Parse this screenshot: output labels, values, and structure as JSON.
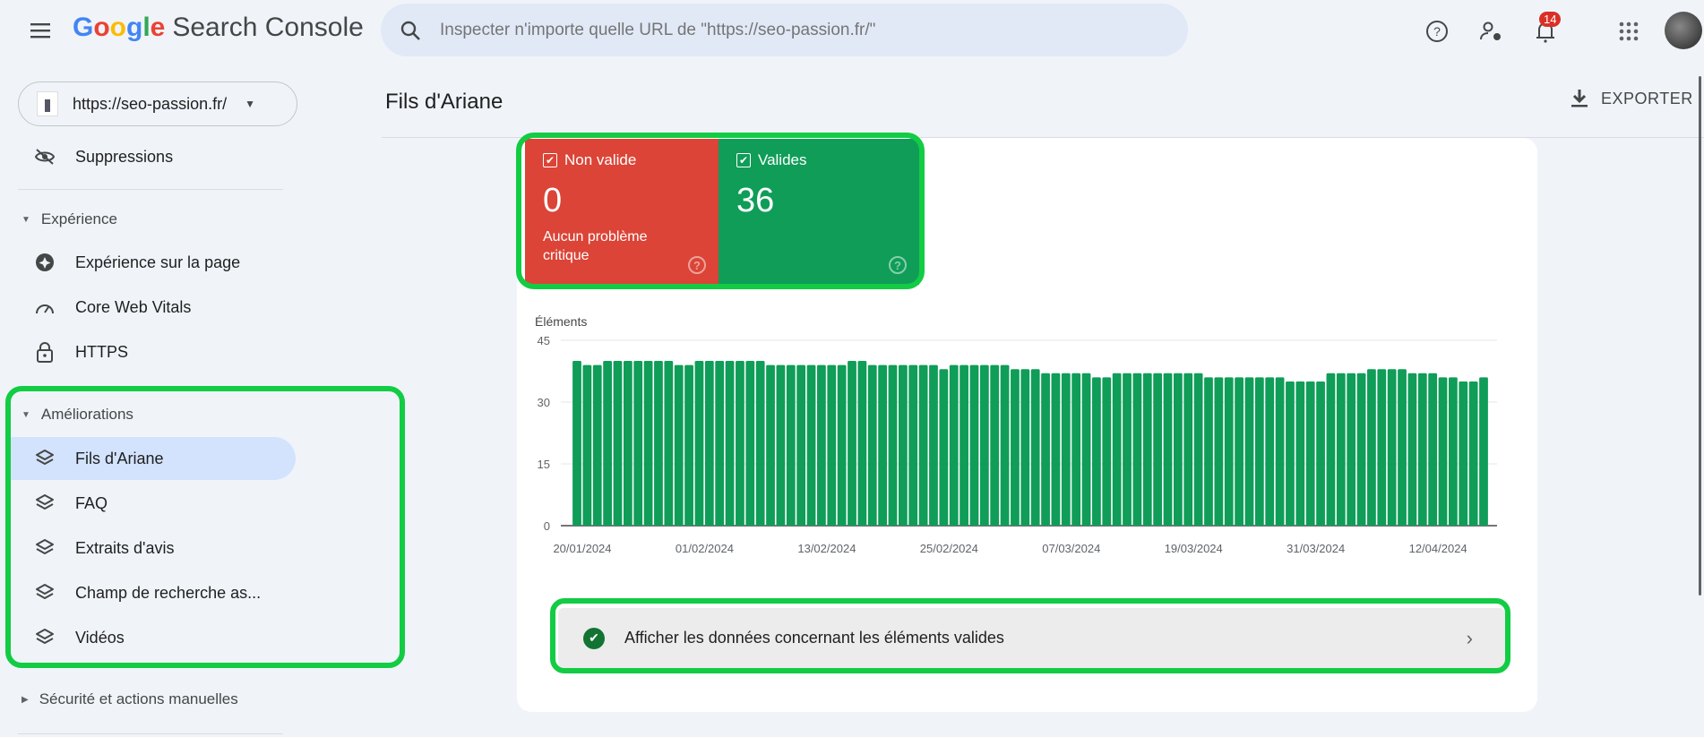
{
  "header": {
    "logo_google": "Google",
    "logo_product": "Search Console",
    "search_placeholder": "Inspecter n'importe quelle URL de \"https://seo-passion.fr/\"",
    "notifications_count": "14"
  },
  "property": {
    "url": "https://seo-passion.fr/"
  },
  "sidebar": {
    "suppressions": "Suppressions",
    "experience_section": "Expérience",
    "experience_items": [
      {
        "label": "Expérience sur la page",
        "icon": "experience-icon"
      },
      {
        "label": "Core Web Vitals",
        "icon": "speed-gauge-icon"
      },
      {
        "label": "HTTPS",
        "icon": "lock-icon"
      }
    ],
    "ameliorations_section": "Améliorations",
    "ameliorations_items": [
      {
        "label": "Fils d'Ariane",
        "icon": "layers-icon",
        "active": true
      },
      {
        "label": "FAQ",
        "icon": "layers-icon"
      },
      {
        "label": "Extraits d'avis",
        "icon": "layers-icon"
      },
      {
        "label": "Champ de recherche as...",
        "icon": "layers-icon"
      },
      {
        "label": "Vidéos",
        "icon": "layers-icon"
      }
    ],
    "security_section": "Sécurité et actions manuelles"
  },
  "page": {
    "title": "Fils d'Ariane",
    "export_label": "EXPORTER"
  },
  "tiles": {
    "invalid": {
      "label": "Non valide",
      "value": "0",
      "subtitle": "Aucun problème critique",
      "color": "#db4437"
    },
    "valid": {
      "label": "Valides",
      "value": "36",
      "color": "#0f9d58"
    }
  },
  "valid_row": {
    "label": "Afficher les données concernant les éléments valides"
  },
  "colors": {
    "highlight": "#12cc44",
    "bar": "#0f9d58"
  },
  "chart_data": {
    "type": "bar",
    "ylabel": "Éléments",
    "ylim": [
      0,
      45
    ],
    "yticks": [
      "0",
      "15",
      "30",
      "45"
    ],
    "xtick_labels": [
      "20/01/2024",
      "01/02/2024",
      "13/02/2024",
      "25/02/2024",
      "07/03/2024",
      "19/03/2024",
      "31/03/2024",
      "12/04/2024"
    ],
    "xtick_every": 12,
    "values": [
      40,
      39,
      39,
      40,
      40,
      40,
      40,
      40,
      40,
      40,
      39,
      39,
      40,
      40,
      40,
      40,
      40,
      40,
      40,
      39,
      39,
      39,
      39,
      39,
      39,
      39,
      39,
      40,
      40,
      39,
      39,
      39,
      39,
      39,
      39,
      39,
      38,
      39,
      39,
      39,
      39,
      39,
      39,
      38,
      38,
      38,
      37,
      37,
      37,
      37,
      37,
      36,
      36,
      37,
      37,
      37,
      37,
      37,
      37,
      37,
      37,
      37,
      36,
      36,
      36,
      36,
      36,
      36,
      36,
      36,
      35,
      35,
      35,
      35,
      37,
      37,
      37,
      37,
      38,
      38,
      38,
      38,
      37,
      37,
      37,
      36,
      36,
      35,
      35,
      36
    ]
  }
}
